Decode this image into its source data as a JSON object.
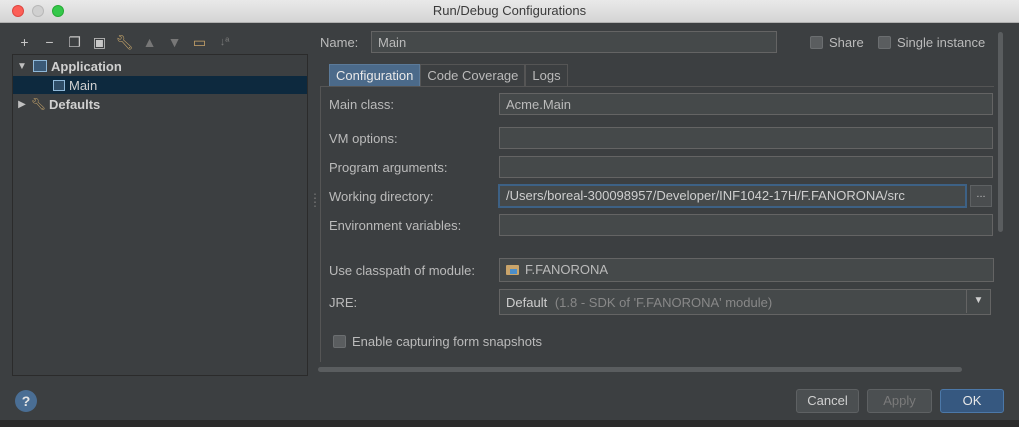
{
  "window": {
    "title": "Run/Debug Configurations"
  },
  "toolbar": {
    "icons": [
      "add-icon",
      "remove-icon",
      "copy-icon",
      "save-icon",
      "wrench-icon",
      "move-up-icon",
      "move-down-icon",
      "folder-icon",
      "sort-icon"
    ]
  },
  "tree": {
    "application_label": "Application",
    "main_label": "Main",
    "defaults_label": "Defaults"
  },
  "name": {
    "label": "Name:",
    "value": "Main"
  },
  "share": {
    "label": "Share",
    "checked": false
  },
  "single_instance": {
    "label": "Single instance",
    "checked": false
  },
  "tabs": [
    {
      "label": "Configuration",
      "active": true
    },
    {
      "label": "Code Coverage",
      "active": false
    },
    {
      "label": "Logs",
      "active": false
    }
  ],
  "form": {
    "main_class": {
      "label": "Main class:",
      "value": "Acme.Main"
    },
    "vm_options": {
      "label": "VM options:",
      "value": ""
    },
    "program_arguments": {
      "label": "Program arguments:",
      "value": ""
    },
    "working_directory": {
      "label": "Working directory:",
      "value": "/Users/boreal-300098957/Developer/INF1042-17H/F.FANORONA/src",
      "browse": "..."
    },
    "environment_variables": {
      "label": "Environment variables:",
      "value": ""
    },
    "classpath_module": {
      "label": "Use classpath of module:",
      "value": "F.FANORONA"
    },
    "jre": {
      "label": "JRE:",
      "value": "Default",
      "detail": "(1.8 - SDK of 'F.FANORONA' module)"
    },
    "snapshots": {
      "label": "Enable capturing form snapshots",
      "checked": false
    }
  },
  "buttons": {
    "help": "?",
    "cancel": "Cancel",
    "apply": "Apply",
    "ok": "OK"
  }
}
